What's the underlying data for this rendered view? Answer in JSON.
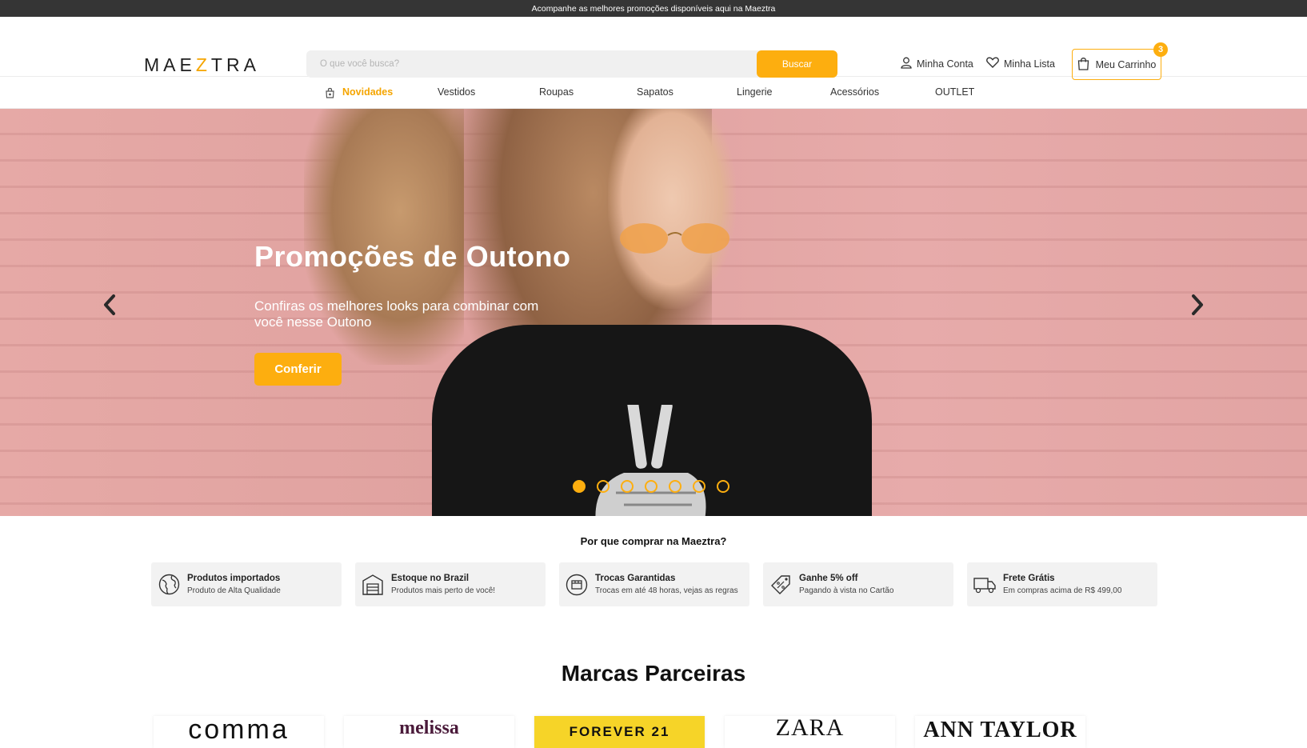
{
  "topbar": {
    "text": "Acompanhe as melhores promoções disponíveis aqui na Maeztra"
  },
  "header": {
    "logo": {
      "pre": "MAE",
      "z": "Z",
      "post": "TRA"
    },
    "search": {
      "placeholder": "O que você busca?",
      "value": "",
      "button": "Buscar"
    },
    "account": "Minha Conta",
    "wishlist": "Minha Lista",
    "cart": {
      "label": "Meu Carrinho",
      "count": "3"
    }
  },
  "nav": {
    "items": [
      {
        "label": "Novidades",
        "active": true
      },
      {
        "label": "Vestidos"
      },
      {
        "label": "Roupas"
      },
      {
        "label": "Sapatos"
      },
      {
        "label": "Lingerie"
      },
      {
        "label": "Acessórios"
      },
      {
        "label": "OUTLET"
      }
    ]
  },
  "hero": {
    "title": "Promoções de Outono",
    "subtitle": "Confiras os melhores looks para combinar com você nesse Outono",
    "button": "Conferir",
    "slides_total": 7,
    "active_slide": 1
  },
  "why": {
    "title": "Por que comprar na Maeztra?",
    "features": [
      {
        "icon": "globe-icon",
        "title": "Produtos importados",
        "subtitle": "Produto de Alta Qualidade"
      },
      {
        "icon": "warehouse-icon",
        "title": "Estoque no Brazil",
        "subtitle": "Produtos mais perto de você!"
      },
      {
        "icon": "exchange-icon",
        "title": "Trocas Garantidas",
        "subtitle": "Trocas em até 48 horas, vejas as regras"
      },
      {
        "icon": "discount-tag-icon",
        "title": "Ganhe 5% off",
        "subtitle": "Pagando à vista no Cartão"
      },
      {
        "icon": "truck-icon",
        "title": "Frete Grátis",
        "subtitle": "Em compras acima de R$ 499,00"
      }
    ]
  },
  "brands": {
    "title": "Marcas Parceiras",
    "items": [
      "comma",
      "melissa",
      "FOREVER 21",
      "ZARA",
      "ANN TAYLOR"
    ]
  },
  "colors": {
    "accent": "#fdae0f",
    "topbar": "#353535"
  }
}
